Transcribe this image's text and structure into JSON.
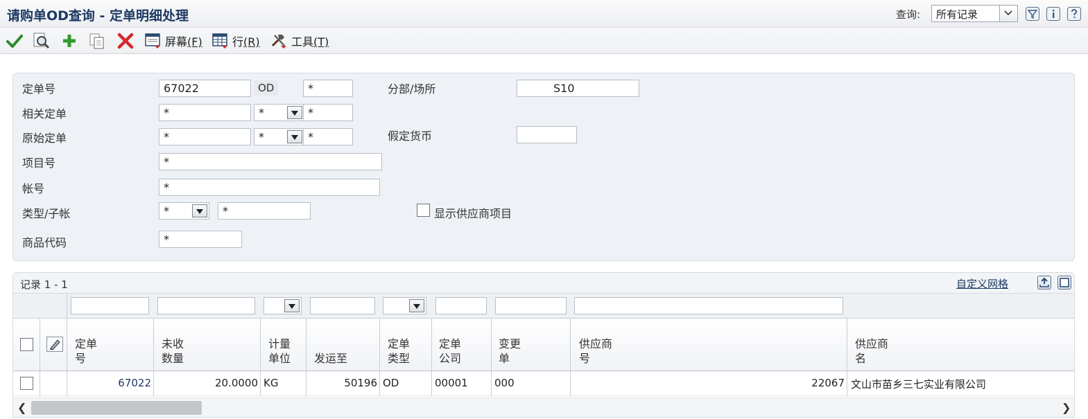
{
  "title_bar": {
    "title": "请购单OD查询 - 定单明细处理",
    "query_label": "查询:",
    "query_value": "所有记录"
  },
  "toolbar": {
    "screen_label": "屏幕",
    "screen_key": "(F)",
    "row_label": "行",
    "row_key": "(R)",
    "tools_label": "工具",
    "tools_key": "(T)"
  },
  "form": {
    "order_no_label": "定单号",
    "order_no_value": "67022",
    "order_type": "OD",
    "order_company": "*",
    "branch_label": "分部/场所",
    "branch_value": "S10",
    "related_label": "相关定单",
    "related_value": "*",
    "related_type": "*",
    "related_company": "*",
    "original_label": "原始定单",
    "original_value": "*",
    "original_type": "*",
    "original_company": "*",
    "currency_label": "假定货币",
    "currency_value": "",
    "item_label": "项目号",
    "item_value": "*",
    "account_label": "帐号",
    "account_value": "*",
    "type_sub_label": "类型/子帐",
    "type_value": "*",
    "sub_value": "*",
    "show_supplier_label": "显示供应商项目",
    "commodity_label": "商品代码",
    "commodity_value": "*"
  },
  "grid": {
    "record_label": "记录 1 - 1",
    "custom_grid_label": "自定义网格",
    "columns": [
      {
        "line1": "定单",
        "line2": "号"
      },
      {
        "line1": "未收",
        "line2": "数量"
      },
      {
        "line1": "计量",
        "line2": "单位"
      },
      {
        "line1": "发运至",
        "line2": ""
      },
      {
        "line1": "定单",
        "line2": "类型"
      },
      {
        "line1": "定单",
        "line2": "公司"
      },
      {
        "line1": "变更",
        "line2": "单"
      },
      {
        "line1": "供应商",
        "line2": "号"
      },
      {
        "line1": "供应商",
        "line2": "名"
      }
    ],
    "rows": [
      {
        "order_no": "67022",
        "open_qty": "20.0000",
        "uom": "KG",
        "ship_to": "50196",
        "order_type": "OD",
        "order_company": "00001",
        "change_order": "000",
        "supplier_no": "22067",
        "supplier_name": "文山市苗乡三七实业有限公司"
      }
    ]
  },
  "colors": {
    "title": "#1d3a63",
    "ok_green": "#2a8a2a",
    "add_green": "#2f9a2f",
    "delete_red": "#d22b2b"
  }
}
